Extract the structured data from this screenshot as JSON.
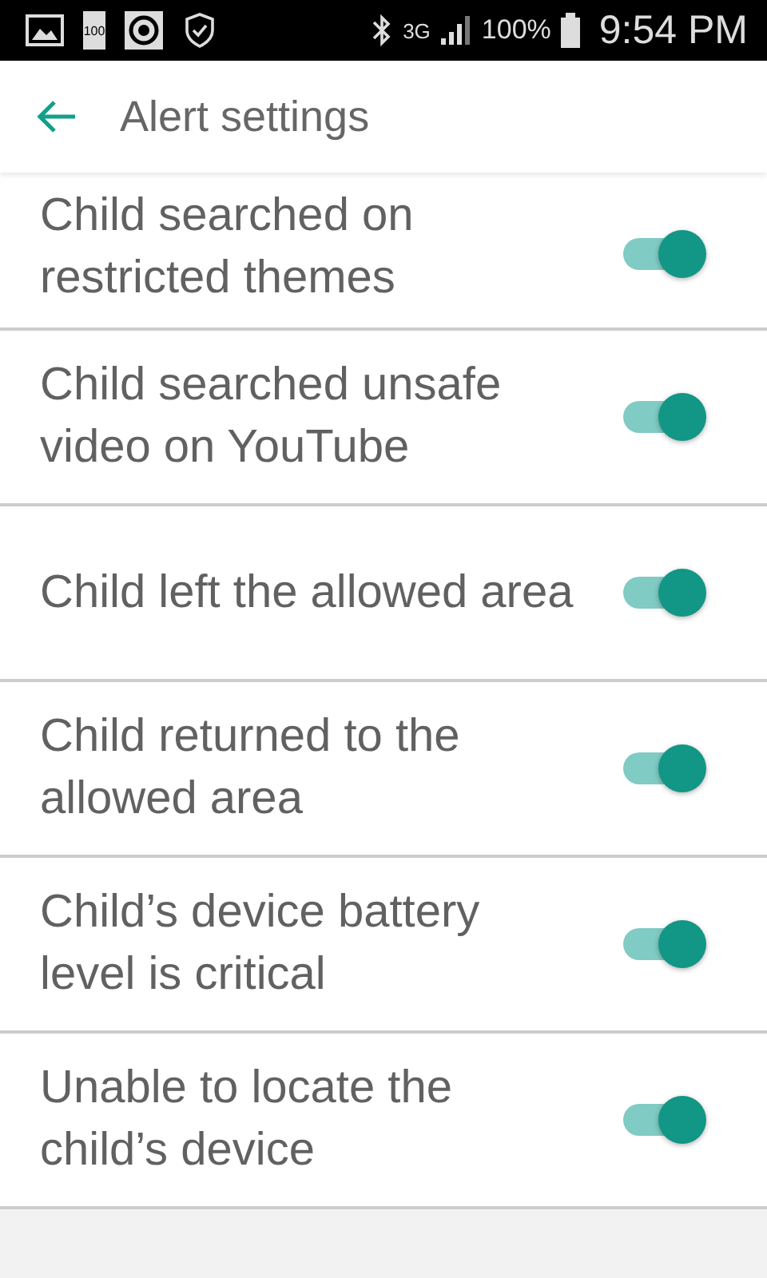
{
  "status_bar": {
    "battery_icon_text": "100",
    "network": "3G",
    "battery": "100%",
    "time": "9:54 PM"
  },
  "header": {
    "title": "Alert settings"
  },
  "settings": [
    {
      "label": "Child searched on restricted themes",
      "on": true
    },
    {
      "label": "Child searched unsafe video on YouTube",
      "on": true
    },
    {
      "label": "Child left the allowed area",
      "on": true
    },
    {
      "label": "Child returned to the allowed area",
      "on": true
    },
    {
      "label": "Child’s device battery level is critical",
      "on": true
    },
    {
      "label": "Unable to locate the child’s device",
      "on": true
    }
  ]
}
